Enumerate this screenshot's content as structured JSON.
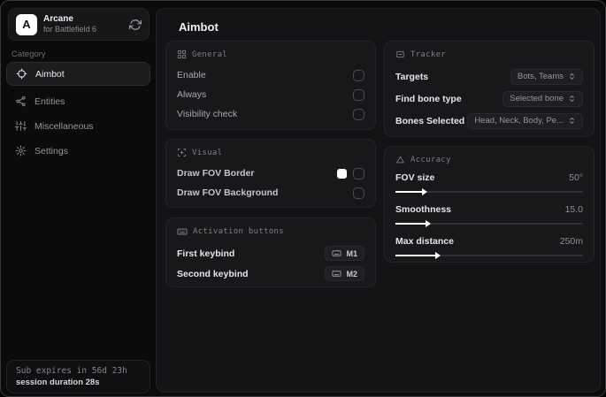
{
  "app": {
    "logo_letter": "A",
    "name": "Arcane",
    "subtitle": "for Battlefield 6"
  },
  "sidebar": {
    "category_label": "Category",
    "items": [
      {
        "label": "Aimbot",
        "icon": "crosshair-icon",
        "active": true
      },
      {
        "label": "Entities",
        "icon": "nodes-icon",
        "active": false
      },
      {
        "label": "Miscellaneous",
        "icon": "sliders-icon",
        "active": false
      },
      {
        "label": "Settings",
        "icon": "gear-icon",
        "active": false
      }
    ],
    "footer": {
      "sub_expires": "Sub expires in 56d 23h",
      "session_duration": "session duration 28s"
    }
  },
  "main": {
    "title": "Aimbot",
    "general": {
      "title": "General",
      "rows": [
        {
          "label": "Enable",
          "checked": false
        },
        {
          "label": "Always",
          "checked": false
        },
        {
          "label": "Visibility check",
          "checked": false
        }
      ]
    },
    "visual": {
      "title": "Visual",
      "rows": [
        {
          "label": "Draw FOV Border",
          "swatch_color": "#ffffff",
          "checked": false
        },
        {
          "label": "Draw FOV Background",
          "checked": false
        }
      ]
    },
    "activation": {
      "title": "Activation buttons",
      "rows": [
        {
          "label": "First keybind",
          "key": "M1"
        },
        {
          "label": "Second keybind",
          "key": "M2"
        }
      ]
    },
    "tracker": {
      "title": "Tracker",
      "rows": [
        {
          "label": "Targets",
          "value": "Bots, Teams"
        },
        {
          "label": "Find bone type",
          "value": "Selected bone"
        },
        {
          "label": "Bones Selected",
          "value": "Head, Neck, Body, Pe..."
        }
      ]
    },
    "accuracy": {
      "title": "Accuracy",
      "rows": [
        {
          "label": "FOV size",
          "value": "50°",
          "fill_pct": 15
        },
        {
          "label": "Smoothness",
          "value": "15.0",
          "fill_pct": 17
        },
        {
          "label": "Max distance",
          "value": "250m",
          "fill_pct": 22
        }
      ]
    }
  },
  "colors": {
    "page_bg": "#0b0b0c",
    "panel_bg": "#141416",
    "card_bg": "#18181b",
    "accent": "#ffffff",
    "fov_border_swatch": "#ffffff"
  }
}
